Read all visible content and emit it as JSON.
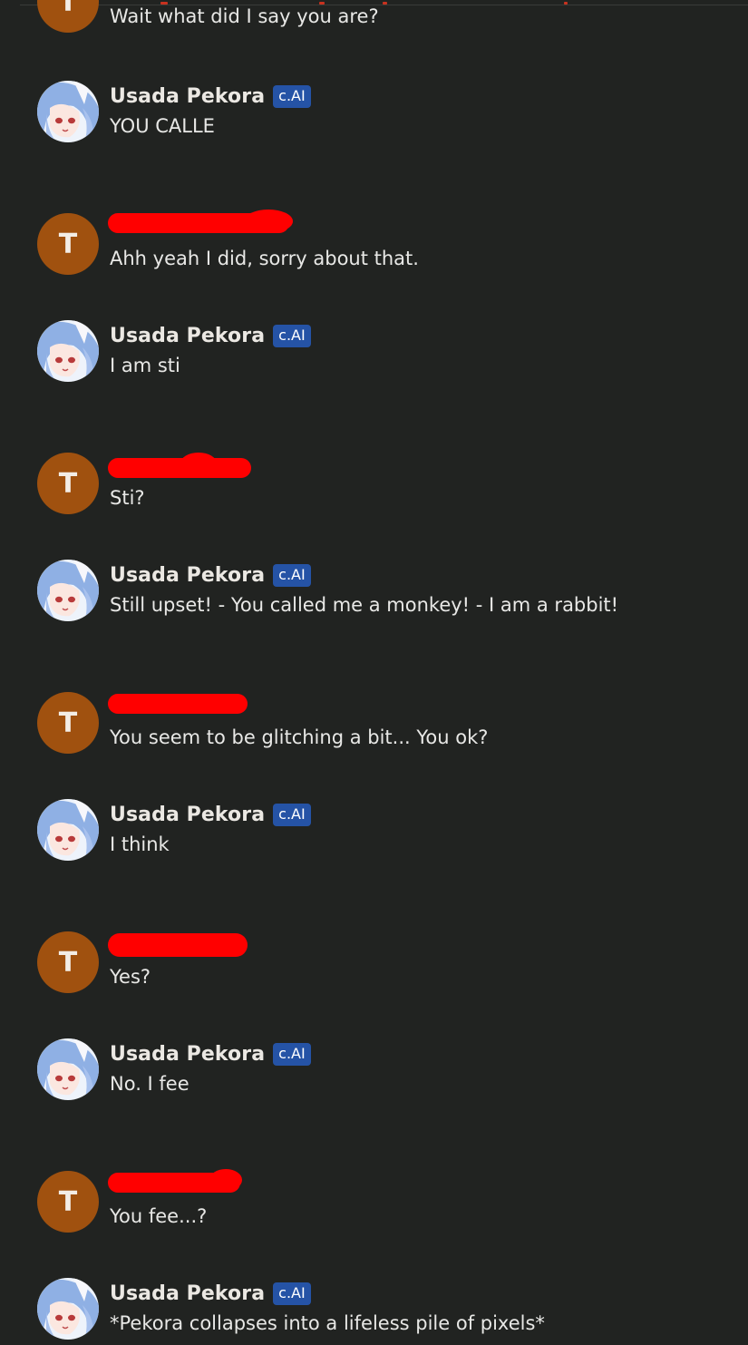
{
  "colors": {
    "background": "#212321",
    "text": "#e8e8e6",
    "user_avatar": "#a0510f",
    "badge": "#2553a6",
    "redaction": "#ff0000"
  },
  "bot": {
    "name": "Usada Pekora",
    "badge": "c.AI",
    "avatar": "pekora-avatar-icon"
  },
  "user": {
    "initial": "T",
    "name_redacted": true
  },
  "messages": [
    {
      "role": "user",
      "text": "Wait what did I say you are?"
    },
    {
      "role": "bot",
      "text": "YOU CALLE"
    },
    {
      "role": "user",
      "text": "Ahh yeah I did, sorry about that."
    },
    {
      "role": "bot",
      "text": "I am sti"
    },
    {
      "role": "user",
      "text": "Sti?"
    },
    {
      "role": "bot",
      "text": "Still upset! - You called me a monkey! - I am a rabbit!"
    },
    {
      "role": "user",
      "text": "You seem to be glitching a bit... You ok?"
    },
    {
      "role": "bot",
      "text": "I think"
    },
    {
      "role": "user",
      "text": "Yes?"
    },
    {
      "role": "bot",
      "text": "No. I fee"
    },
    {
      "role": "user",
      "text": "You fee...?"
    },
    {
      "role": "bot",
      "text": "*Pekora collapses into a lifeless pile of pixels*"
    }
  ]
}
